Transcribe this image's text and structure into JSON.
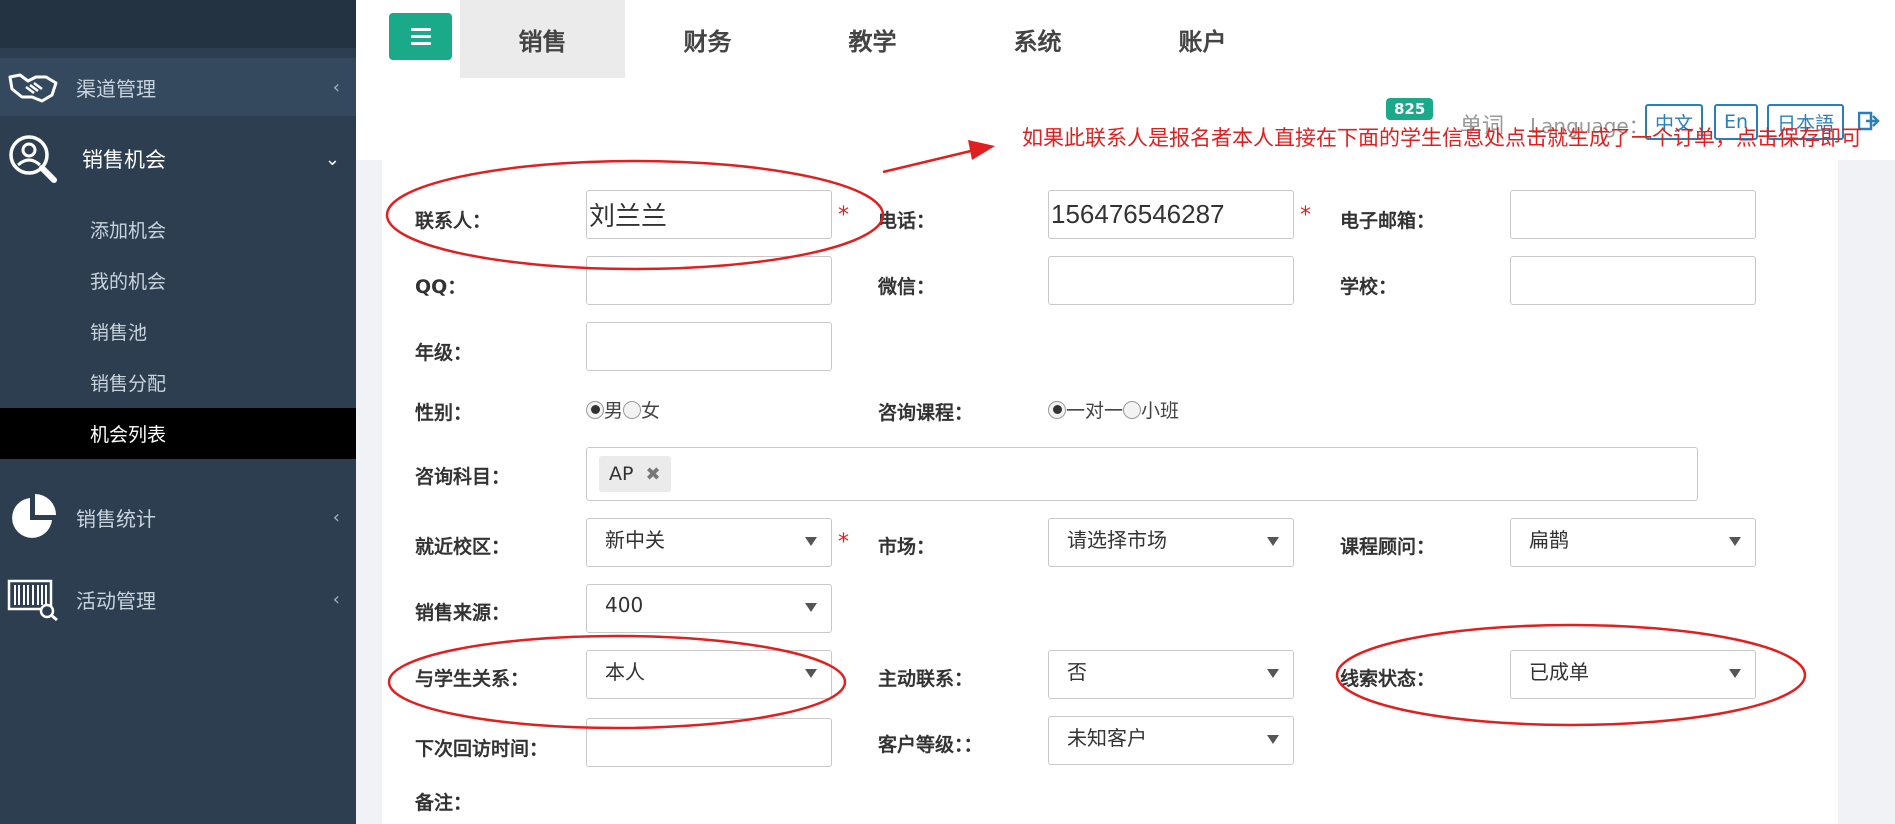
{
  "sidebar": {
    "items": [
      {
        "label": "渠道管理",
        "icon": "handshake-icon",
        "expanded": false
      },
      {
        "label": "销售机会",
        "icon": "user-search-icon",
        "expanded": true
      },
      {
        "label": "销售统计",
        "icon": "pie-chart-icon",
        "expanded": false
      },
      {
        "label": "活动管理",
        "icon": "barcode-scan-icon",
        "expanded": false
      }
    ],
    "sub_items": [
      "添加机会",
      "我的机会",
      "销售池",
      "销售分配",
      "机会列表"
    ],
    "selected_sub": "机会列表"
  },
  "tabs": [
    "销售",
    "财务",
    "教学",
    "系统",
    "账户"
  ],
  "active_tab": "销售",
  "header": {
    "badge": "825",
    "word": "单词",
    "language_label": "Language：",
    "languages": [
      "中文",
      "En",
      "日本語"
    ]
  },
  "annotation": {
    "text": "如果此联系人是报名者本人直接在下面的学生信息处点击就生成了一个订单，点击保存即可",
    "color": "#e02020"
  },
  "form": {
    "contact": {
      "label": "联系人：",
      "value": "刘兰兰"
    },
    "phone": {
      "label": "电话：",
      "value": "156476546287"
    },
    "email": {
      "label": "电子邮箱：",
      "value": ""
    },
    "qq": {
      "label": "QQ：",
      "value": ""
    },
    "wechat": {
      "label": "微信：",
      "value": ""
    },
    "school": {
      "label": "学校：",
      "value": ""
    },
    "grade": {
      "label": "年级：",
      "value": ""
    },
    "gender": {
      "label": "性别：",
      "options": [
        "男",
        "女"
      ],
      "selected": "男"
    },
    "course": {
      "label": "咨询课程：",
      "options": [
        "一对一",
        "小班"
      ],
      "selected": "一对一"
    },
    "subject": {
      "label": "咨询科目：",
      "tags": [
        "AP"
      ]
    },
    "campus": {
      "label": "就近校区：",
      "value": "新中关"
    },
    "market": {
      "label": "市场：",
      "value": "请选择市场"
    },
    "advisor": {
      "label": "课程顾问：",
      "value": "扁鹊"
    },
    "source": {
      "label": "销售来源：",
      "value": "400"
    },
    "relation": {
      "label": "与学生关系：",
      "value": "本人"
    },
    "active_contact": {
      "label": "主动联系：",
      "value": "否"
    },
    "lead_status": {
      "label": "线索状态：",
      "value": "已成单"
    },
    "next_visit": {
      "label": "下次回访时间：",
      "value": ""
    },
    "customer_level": {
      "label": "客户等级：：",
      "value": "未知客户"
    },
    "notes": {
      "label": "备注："
    },
    "required_mark": "*"
  },
  "colors": {
    "sidebar": "#2c3e50",
    "accent": "#1aaa8a",
    "annotation": "#e02020",
    "link": "#2a7fb8"
  }
}
